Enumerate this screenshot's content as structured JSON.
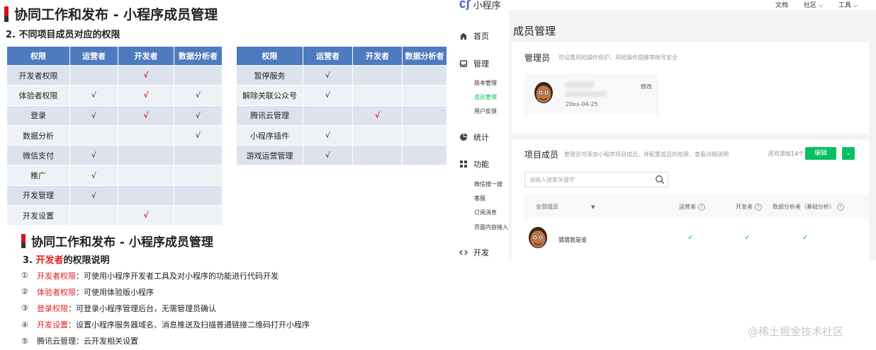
{
  "slide": {
    "title1": "协同工作和发布 - 小程序成员管理",
    "subtitle1": "2. 不同项目成员对应的权限",
    "tableA": {
      "headers": [
        "权限",
        "运营者",
        "开发者",
        "数据分析者"
      ],
      "rows": [
        {
          "label": "开发者权限",
          "ops": "",
          "dev": "√",
          "data": "",
          "dev_red": true
        },
        {
          "label": "体验者权限",
          "ops": "√",
          "dev": "√",
          "data": "√",
          "dev_red": true
        },
        {
          "label": "登录",
          "ops": "√",
          "dev": "√",
          "data": "√",
          "dev_red": true
        },
        {
          "label": "数据分析",
          "ops": "",
          "dev": "",
          "data": "√",
          "dev_red": false
        },
        {
          "label": "微信支付",
          "ops": "√",
          "dev": "",
          "data": "",
          "dev_red": false
        },
        {
          "label": "推广",
          "ops": "√",
          "dev": "",
          "data": "",
          "dev_red": false
        },
        {
          "label": "开发管理",
          "ops": "√",
          "dev": "",
          "data": "",
          "dev_red": false
        },
        {
          "label": "开发设置",
          "ops": "",
          "dev": "√",
          "data": "",
          "dev_red": true
        }
      ]
    },
    "tableB": {
      "headers": [
        "权限",
        "运营者",
        "开发者",
        "数据分析者"
      ],
      "rows": [
        {
          "label": "暂停服务",
          "ops": "√",
          "dev": "",
          "data": "",
          "dev_red": false
        },
        {
          "label": "解除关联公众号",
          "ops": "√",
          "dev": "",
          "data": "",
          "dev_red": false
        },
        {
          "label": "腾讯云管理",
          "ops": "",
          "dev": "√",
          "data": "",
          "dev_red": true
        },
        {
          "label": "小程序插件",
          "ops": "√",
          "dev": "",
          "data": "",
          "dev_red": false
        },
        {
          "label": "游戏运营管理",
          "ops": "√",
          "dev": "",
          "data": "",
          "dev_red": false
        }
      ]
    },
    "title2": "协同工作和发布 - 小程序成员管理",
    "subtitle2_prefix": "3. ",
    "subtitle2_highlight": "开发者",
    "subtitle2_suffix": "的权限说明",
    "perm_list": [
      {
        "num": "①",
        "term": "开发者权限",
        "desc": "：可使用小程序开发者工具及对小程序的功能进行代码开发",
        "red": true
      },
      {
        "num": "②",
        "term": "体验者权限",
        "desc": "：可使用体验版小程序",
        "red": true
      },
      {
        "num": "③",
        "term": "登录权限",
        "desc": "：可登录小程序管理后台，无需管理员确认",
        "red": true
      },
      {
        "num": "④",
        "term": "开发设置",
        "desc": "：设置小程序服务器域名、消息推送及扫描普通链接二维码打开小程序",
        "red": true
      },
      {
        "num": "⑤",
        "term": "腾讯云管理",
        "desc": "：云开发相关设置",
        "red": false
      }
    ]
  },
  "app": {
    "logo_text": "小程序",
    "topnav": [
      "文档",
      "社区",
      "工具"
    ],
    "sidebar": {
      "home": "首页",
      "manage": "管理",
      "manage_items": [
        "版本管理",
        "成员管理",
        "用户反馈"
      ],
      "stats": "统计",
      "features": "功能",
      "feature_items": [
        "微信搜一搜",
        "客服",
        "订阅消息",
        "页面内容接入"
      ],
      "dev": "开发"
    },
    "page_title": "成员管理",
    "admin": {
      "title": "管理员",
      "desc": "可设置风险操作保护、风险操作提醒等帐号安全",
      "date": "20xx-04-25",
      "edit": "修改"
    },
    "members": {
      "title": "项目成员",
      "desc": "管理员可添加小程序项目成员，并配置成员的权限，查看详细说明",
      "quota": "还可添加14个",
      "edit_button": "编辑",
      "search_placeholder": "请输入搜索关键字",
      "columns": [
        "全部成员",
        "运营者",
        "开发者",
        "数据分析者（基础分析）"
      ],
      "rows": [
        {
          "name": "猜猜我是谁",
          "ops": "✓",
          "dev": "✓",
          "data": "✓"
        }
      ]
    }
  },
  "watermark": "@稀土掘金技术社区",
  "colors": {
    "table_header": "#4e7bbf",
    "accent_green": "#07c160",
    "red": "#dd2222"
  }
}
